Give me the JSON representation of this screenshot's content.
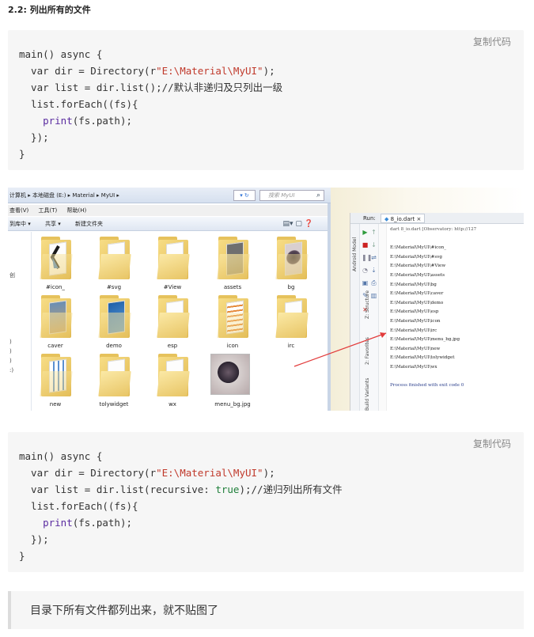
{
  "heading": "2.2: 列出所有的文件",
  "code1": {
    "copy_label": "复制代码",
    "line1": "main() async {",
    "l2_pre": "  var dir = Directory(r",
    "l2_str": "\"E:\\Material\\MyUI\"",
    "l2_post": ");",
    "l3": "  var list = dir.list();//默认非递归及只列出一级",
    "l4": "  list.forEach((fs){",
    "l5_fn": "print",
    "l5_post": "(fs.path);",
    "l6": "  });",
    "l7": "}"
  },
  "explorer": {
    "breadcrumb": "计算机 ▸ 本地磁盘 (E:) ▸ Material ▸ MyUI ▸",
    "nav_buttons": "▾ ↻",
    "search_placeholder": "搜索 MyUI",
    "menu": [
      "查看(V)",
      "工具(T)",
      "帮助(H)"
    ],
    "toolbar": [
      "到库中 ▾",
      "共享 ▾",
      "新建文件夹"
    ],
    "toolbar_icons": "▤▾ ▢ ❓",
    "nav_labels": [
      "创",
      ")",
      ")",
      ")",
      ":)"
    ],
    "items": [
      {
        "label": "#icon_",
        "kind": "folder-k"
      },
      {
        "label": "#svg",
        "kind": "folder"
      },
      {
        "label": "#View",
        "kind": "folder-paper"
      },
      {
        "label": "assets",
        "kind": "folder-dark"
      },
      {
        "label": "bg",
        "kind": "folder-photo"
      },
      {
        "label": "caver",
        "kind": "folder-photo2"
      },
      {
        "label": "demo",
        "kind": "folder-blue"
      },
      {
        "label": "esp",
        "kind": "folder-paper"
      },
      {
        "label": "icon",
        "kind": "folder-grid"
      },
      {
        "label": "irc",
        "kind": "folder"
      },
      {
        "label": "new",
        "kind": "folder-grid2"
      },
      {
        "label": "tolywidget",
        "kind": "folder-paper2"
      },
      {
        "label": "wx",
        "kind": "folder-paper"
      },
      {
        "label": "menu_bg.jpg",
        "kind": "image"
      }
    ]
  },
  "ide": {
    "run_label": "Run:",
    "tab_label": "8_io.dart",
    "cmd": "dart 8_io.dart [Observatory: http://127",
    "lines": [
      "E:\\Material\\MyUI\\#icon_",
      "E:\\Material\\MyUI\\#svg",
      "E:\\Material\\MyUI\\#View",
      "E:\\Material\\MyUI\\assets",
      "E:\\Material\\MyUI\\bg",
      "E:\\Material\\MyUI\\caver",
      "E:\\Material\\MyUI\\demo",
      "E:\\Material\\MyUI\\esp",
      "E:\\Material\\MyUI\\icon",
      "E:\\Material\\MyUI\\irc",
      "E:\\Material\\MyUI\\menu_bg.jpg",
      "E:\\Material\\MyUI\\new",
      "E:\\Material\\MyUI\\tolywidget",
      "E:\\Material\\MyUI\\wx"
    ],
    "done": "Process finished with exit code 0",
    "side_labels": [
      "Z: Structure",
      "2: Favorites",
      "Build Variants"
    ],
    "left_tab": "Android Model",
    "colors": {
      "accent_green": "#2e9b3c",
      "stop_red": "#d0332f",
      "arrow": "#e23b3b"
    }
  },
  "code2": {
    "copy_label": "复制代码",
    "line1": "main() async {",
    "l2_pre": "  var dir = Directory(r",
    "l2_str": "\"E:\\Material\\MyUI\"",
    "l2_post": ");",
    "l3_pre": "  var list = dir.list(recursive: ",
    "l3_kw": "true",
    "l3_post": ");//递归列出所有文件",
    "l4": "  list.forEach((fs){",
    "l5_fn": "print",
    "l5_post": "(fs.path);",
    "l6": "  });",
    "l7": "}"
  },
  "note": "目录下所有文件都列出来，就不贴图了"
}
